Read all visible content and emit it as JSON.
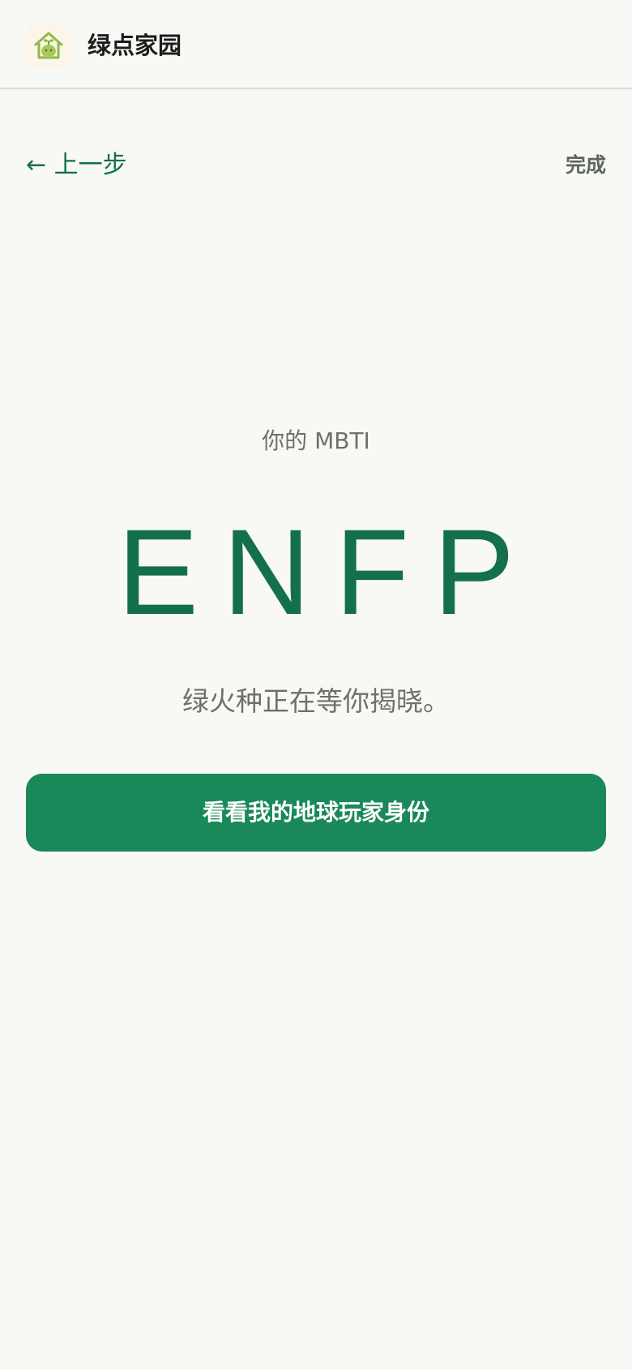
{
  "header": {
    "logo_icon": "house-sprout-icon",
    "app_title": "绿点家园"
  },
  "nav": {
    "back_label": "← 上一步",
    "done_label": "完成"
  },
  "result": {
    "caption": "你的 MBTI",
    "mbti_type": "ENFP",
    "subtitle": "绿火种正在等你揭晓。"
  },
  "cta": {
    "label": "看看我的地球玩家身份"
  },
  "colors": {
    "accent": "#13704b",
    "button": "#1a8858",
    "background": "#f8f8f5"
  }
}
